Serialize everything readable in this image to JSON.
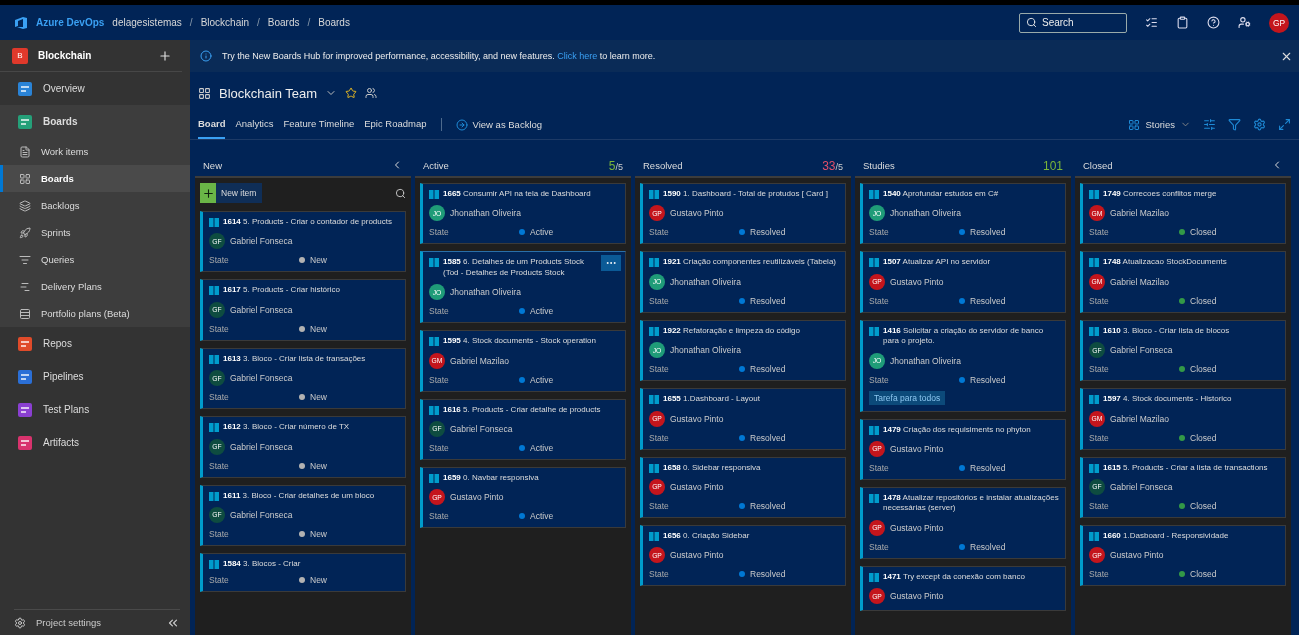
{
  "topbar": {
    "brand": "Azure DevOps",
    "breadcrumbs": [
      "delagesistemas",
      "Blockchain",
      "Boards",
      "Boards"
    ],
    "separator": "/",
    "search": {
      "placeholder": "Search"
    },
    "avatar": "GP"
  },
  "sidebar": {
    "project": {
      "initial": "B",
      "name": "Blockchain"
    },
    "items": [
      {
        "label": "Overview",
        "selected": false
      },
      {
        "label": "Boards",
        "selected": false,
        "expanded": true,
        "children": [
          {
            "label": "Work items",
            "selected": false
          },
          {
            "label": "Boards",
            "selected": true
          },
          {
            "label": "Backlogs",
            "selected": false
          },
          {
            "label": "Sprints",
            "selected": false
          },
          {
            "label": "Queries",
            "selected": false
          },
          {
            "label": "Delivery Plans",
            "selected": false
          },
          {
            "label": "Portfolio plans (Beta)",
            "selected": false
          }
        ]
      },
      {
        "label": "Repos",
        "selected": false
      },
      {
        "label": "Pipelines",
        "selected": false
      },
      {
        "label": "Test Plans",
        "selected": false
      },
      {
        "label": "Artifacts",
        "selected": false
      }
    ],
    "footer": "Project settings"
  },
  "banner": {
    "text": "Try the New Boards Hub for improved performance, accessibility, and new features.",
    "link": "Click here",
    "after": "to learn more."
  },
  "team": {
    "name": "Blockchain Team"
  },
  "tabs": [
    {
      "label": "Board",
      "selected": true
    },
    {
      "label": "Analytics",
      "selected": false
    },
    {
      "label": "Feature Timeline",
      "selected": false
    },
    {
      "label": "Epic Roadmap",
      "selected": false
    }
  ],
  "view_as_backlog": "View as Backlog",
  "backlog_level": "Stories",
  "columns": [
    {
      "name": "New",
      "collapsible": true,
      "new_item": "New item",
      "cards": [
        {
          "id": "1614",
          "title": "5. Products - Criar o contador de products",
          "assignee": {
            "initials": "GF",
            "name": "Gabriel Fonseca",
            "color": "#0e4c40"
          },
          "state": {
            "label": "State",
            "value": "New",
            "color": "#b2b2b2"
          },
          "hovered": false
        },
        {
          "id": "1617",
          "title": "5. Products - Criar histórico",
          "assignee": {
            "initials": "GF",
            "name": "Gabriel Fonseca",
            "color": "#0e4c40"
          },
          "state": {
            "label": "State",
            "value": "New",
            "color": "#b2b2b2"
          },
          "hovered": false
        },
        {
          "id": "1613",
          "title": "3. Bloco - Criar lista de transações",
          "assignee": {
            "initials": "GF",
            "name": "Gabriel Fonseca",
            "color": "#0e4c40"
          },
          "state": {
            "label": "State",
            "value": "New",
            "color": "#b2b2b2"
          },
          "hovered": false
        },
        {
          "id": "1612",
          "title": "3. Bloco - Criar número de TX",
          "assignee": {
            "initials": "GF",
            "name": "Gabriel Fonseca",
            "color": "#0e4c40"
          },
          "state": {
            "label": "State",
            "value": "New",
            "color": "#b2b2b2"
          },
          "hovered": false
        },
        {
          "id": "1611",
          "title": "3. Bloco - Criar detalhes de um bloco",
          "assignee": {
            "initials": "GF",
            "name": "Gabriel Fonseca",
            "color": "#0e4c40"
          },
          "state": {
            "label": "State",
            "value": "New",
            "color": "#b2b2b2"
          },
          "hovered": false
        },
        {
          "id": "1584",
          "title": "3. Blocos - Criar",
          "state": {
            "label": "State",
            "value": "New",
            "color": "#b2b2b2"
          },
          "hovered": false
        }
      ]
    },
    {
      "name": "Active",
      "count": "5",
      "limit": "/5",
      "over_limit": false,
      "cards": [
        {
          "id": "1665",
          "title": "Consumir API na tela de Dashboard",
          "assignee": {
            "initials": "JO",
            "name": "Jhonathan Oliveira",
            "color": "#1f9c78"
          },
          "state": {
            "label": "State",
            "value": "Active",
            "color": "#0078d4"
          },
          "hovered": false
        },
        {
          "id": "1585",
          "title": "6. Detalhes de um Products Stock (Tod - Detalhes de Products Stock",
          "assignee": {
            "initials": "JO",
            "name": "Jhonathan Oliveira",
            "color": "#1f9c78"
          },
          "state": {
            "label": "State",
            "value": "Active",
            "color": "#0078d4"
          },
          "hovered": true
        },
        {
          "id": "1595",
          "title": "4. Stock documents - Stock operation",
          "assignee": {
            "initials": "GM",
            "name": "Gabriel Mazilao",
            "color": "#c4151c"
          },
          "state": {
            "label": "State",
            "value": "Active",
            "color": "#0078d4"
          },
          "hovered": false
        },
        {
          "id": "1616",
          "title": "5. Products - Criar detalhe de products",
          "assignee": {
            "initials": "GF",
            "name": "Gabriel Fonseca",
            "color": "#0e4c40"
          },
          "state": {
            "label": "State",
            "value": "Active",
            "color": "#0078d4"
          },
          "hovered": false
        },
        {
          "id": "1659",
          "title": "0. Navbar responsiva",
          "assignee": {
            "initials": "GP",
            "name": "Gustavo Pinto",
            "color": "#c4151c"
          },
          "state": {
            "label": "State",
            "value": "Active",
            "color": "#0078d4"
          },
          "hovered": false
        }
      ]
    },
    {
      "name": "Resolved",
      "count": "33",
      "limit": "/5",
      "over_limit": true,
      "cards": [
        {
          "id": "1590",
          "title": "1. Dashboard - Total de protudos  [ Card ]",
          "assignee": {
            "initials": "GP",
            "name": "Gustavo Pinto",
            "color": "#c4151c"
          },
          "state": {
            "label": "State",
            "value": "Resolved",
            "color": "#0078d4"
          },
          "hovered": false
        },
        {
          "id": "1921",
          "title": "Criação componentes reutilizáveis (Tabela)",
          "assignee": {
            "initials": "JO",
            "name": "Jhonathan Oliveira",
            "color": "#1f9c78"
          },
          "state": {
            "label": "State",
            "value": "Resolved",
            "color": "#0078d4"
          },
          "hovered": false
        },
        {
          "id": "1922",
          "title": "Refatoração e limpeza do código",
          "assignee": {
            "initials": "JO",
            "name": "Jhonathan Oliveira",
            "color": "#1f9c78"
          },
          "state": {
            "label": "State",
            "value": "Resolved",
            "color": "#0078d4"
          },
          "hovered": false
        },
        {
          "id": "1655",
          "title": "1.Dashboard -  Layout",
          "assignee": {
            "initials": "GP",
            "name": "Gustavo Pinto",
            "color": "#c4151c"
          },
          "state": {
            "label": "State",
            "value": "Resolved",
            "color": "#0078d4"
          },
          "hovered": false
        },
        {
          "id": "1658",
          "title": "0. Sidebar responsiva",
          "assignee": {
            "initials": "GP",
            "name": "Gustavo Pinto",
            "color": "#c4151c"
          },
          "state": {
            "label": "State",
            "value": "Resolved",
            "color": "#0078d4"
          },
          "hovered": false
        },
        {
          "id": "1656",
          "title": "0. Criação Sidebar",
          "assignee": {
            "initials": "GP",
            "name": "Gustavo Pinto",
            "color": "#c4151c"
          },
          "state": {
            "label": "State",
            "value": "Resolved",
            "color": "#0078d4"
          },
          "hovered": false
        }
      ]
    },
    {
      "name": "Studies",
      "count": "101",
      "over_limit": false,
      "cards": [
        {
          "id": "1540",
          "title": "Aprofundar estudos em C#",
          "assignee": {
            "initials": "JO",
            "name": "Jhonathan Oliveira",
            "color": "#1f9c78"
          },
          "state": {
            "label": "State",
            "value": "Resolved",
            "color": "#0078d4"
          },
          "hovered": false
        },
        {
          "id": "1507",
          "title": "Atualizar API no servidor",
          "assignee": {
            "initials": "GP",
            "name": "Gustavo Pinto",
            "color": "#c4151c"
          },
          "state": {
            "label": "State",
            "value": "Resolved",
            "color": "#0078d4"
          },
          "hovered": false
        },
        {
          "id": "1416",
          "title": "Solicitar a criação do servidor de banco para o projeto.",
          "assignee": {
            "initials": "JO",
            "name": "Jhonathan Oliveira",
            "color": "#1f9c78"
          },
          "state": {
            "label": "State",
            "value": "Resolved",
            "color": "#0078d4"
          },
          "tags": [
            "Tarefa para todos"
          ],
          "hovered": false
        },
        {
          "id": "1479",
          "title": "Criação dos requisiments no phyton",
          "assignee": {
            "initials": "GP",
            "name": "Gustavo Pinto",
            "color": "#c4151c"
          },
          "state": {
            "label": "State",
            "value": "Resolved",
            "color": "#0078d4"
          },
          "hovered": false
        },
        {
          "id": "1478",
          "title": "Atualizar repositórios e instalar atualizações necessárias (server)",
          "assignee": {
            "initials": "GP",
            "name": "Gustavo Pinto",
            "color": "#c4151c"
          },
          "state": {
            "label": "State",
            "value": "Resolved",
            "color": "#0078d4"
          },
          "hovered": false
        },
        {
          "id": "1471",
          "title": "Try except da conexão com banco",
          "assignee": {
            "initials": "GP",
            "name": "Gustavo Pinto",
            "color": "#c4151c"
          },
          "hovered": false
        }
      ]
    },
    {
      "name": "Closed",
      "collapsible": true,
      "cards": [
        {
          "id": "1749",
          "title": "Correcoes conflitos merge",
          "assignee": {
            "initials": "GM",
            "name": "Gabriel Mazilao",
            "color": "#c4151c"
          },
          "state": {
            "label": "State",
            "value": "Closed",
            "color": "#339947"
          },
          "hovered": false
        },
        {
          "id": "1748",
          "title": "Atualizacao StockDocuments",
          "assignee": {
            "initials": "GM",
            "name": "Gabriel Mazilao",
            "color": "#c4151c"
          },
          "state": {
            "label": "State",
            "value": "Closed",
            "color": "#339947"
          },
          "hovered": false
        },
        {
          "id": "1610",
          "title": "3. Bloco - Criar lista de blocos",
          "assignee": {
            "initials": "GF",
            "name": "Gabriel Fonseca",
            "color": "#0e4c40"
          },
          "state": {
            "label": "State",
            "value": "Closed",
            "color": "#339947"
          },
          "hovered": false
        },
        {
          "id": "1597",
          "title": "4. Stock documents - Historico",
          "assignee": {
            "initials": "GM",
            "name": "Gabriel Mazilao",
            "color": "#c4151c"
          },
          "state": {
            "label": "State",
            "value": "Closed",
            "color": "#339947"
          },
          "hovered": false
        },
        {
          "id": "1615",
          "title": "5. Products - Criar a lista de transactions",
          "assignee": {
            "initials": "GF",
            "name": "Gabriel Fonseca",
            "color": "#0e4c40"
          },
          "state": {
            "label": "State",
            "value": "Closed",
            "color": "#339947"
          },
          "hovered": false
        },
        {
          "id": "1660",
          "title": "1.Dasboard - Responsividade",
          "assignee": {
            "initials": "GP",
            "name": "Gustavo Pinto",
            "color": "#c4151c"
          },
          "state": {
            "label": "State",
            "value": "Closed",
            "color": "#339947"
          },
          "hovered": false
        }
      ]
    }
  ]
}
